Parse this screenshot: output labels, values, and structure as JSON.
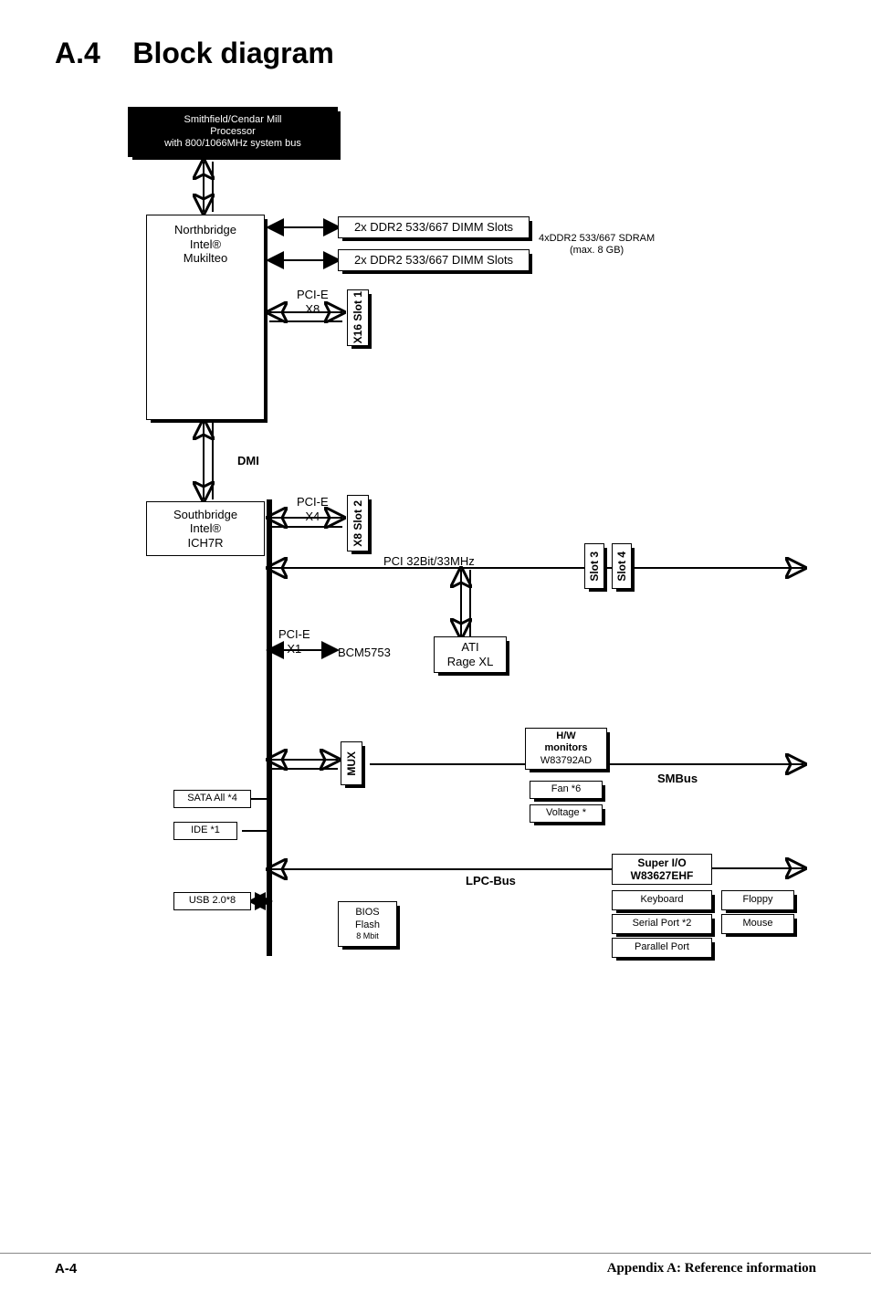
{
  "title_sec": "A.4",
  "title_text": "Block diagram",
  "cpu": {
    "l1": "Smithfield/Cendar Mill",
    "l2": "Processor",
    "l3": "with 800/1066MHz system bus"
  },
  "north": {
    "l1": "Northbridge",
    "l2": "Intel®",
    "l3": "Mukilteo"
  },
  "dimm_top": "2x DDR2 533/667 DIMM Slots",
  "dimm_bot": "2x DDR2 533/667 DIMM Slots",
  "ddr_side": {
    "l1": "4xDDR2 533/667 SDRAM",
    "l2": "(max. 8 GB)"
  },
  "pcie_x8": "PCI-E\nX8",
  "x16slot1": "X16 Slot 1",
  "dmi": "DMI",
  "south": {
    "l1": "Southbridge",
    "l2": "Intel®",
    "l3": "ICH7R"
  },
  "pcie_x4": "PCI-E\nX4",
  "x8slot2": "X8 Slot 2",
  "pci_bus": "PCI 32Bit/33MHz",
  "slot3": "Slot 3",
  "slot4": "Slot 4",
  "pcie_x1": "PCI-E\nX1",
  "bcm": "BCM5753",
  "ati": {
    "l1": "ATI",
    "l2": "Rage XL"
  },
  "mux": "MUX",
  "hw": {
    "l1": "H/W",
    "l2": "monitors",
    "l3": "W83792AD"
  },
  "fan": "Fan *6",
  "voltage": "Voltage *",
  "smbus": "SMBus",
  "sata": "SATA All *4",
  "ide": "IDE *1",
  "usb": "USB 2.0*8",
  "lpc": "LPC-Bus",
  "bios": {
    "l1": "BIOS",
    "l2": "Flash",
    "l3": "8 Mbit"
  },
  "sio": {
    "l1": "Super I/O",
    "l2": "W83627EHF"
  },
  "kb": "Keyboard",
  "serial": "Serial Port *2",
  "parallel": "Parallel Port",
  "floppy": "Floppy",
  "mouse": "Mouse",
  "footer_left": "A-4",
  "footer_right_app": "Appendix A: ",
  "footer_right_info": "Reference information"
}
